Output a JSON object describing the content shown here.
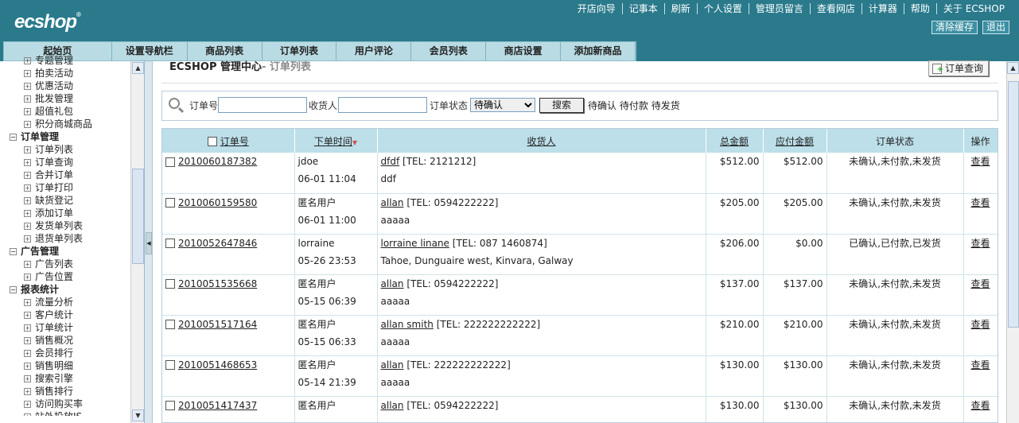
{
  "header": {
    "logo": "ecshop",
    "top_links": [
      "开店向导",
      "记事本",
      "刷新",
      "个人设置",
      "管理员留言",
      "查看网店",
      "计算器",
      "帮助",
      "关于 ECSHOP"
    ],
    "buttons": [
      "清除缓存",
      "退出"
    ]
  },
  "nav": [
    "起始页",
    "设置导航栏",
    "商品列表",
    "订单列表",
    "用户评论",
    "会员列表",
    "商店设置",
    "添加新商品"
  ],
  "sidebar": {
    "groups": [
      {
        "title": null,
        "items": [
          "专题管理",
          "拍卖活动",
          "优惠活动",
          "批发管理",
          "超值礼包",
          "积分商城商品"
        ]
      },
      {
        "title": "订单管理",
        "items": [
          "订单列表",
          "订单查询",
          "合并订单",
          "订单打印",
          "缺货登记",
          "添加订单",
          "发货单列表",
          "退货单列表"
        ]
      },
      {
        "title": "广告管理",
        "items": [
          "广告列表",
          "广告位置"
        ]
      },
      {
        "title": "报表统计",
        "items": [
          "流量分析",
          "客户统计",
          "订单统计",
          "销售概况",
          "会员排行",
          "销售明细",
          "搜索引擎",
          "销售排行",
          "访问购买率",
          "站外投放JS"
        ]
      }
    ]
  },
  "page": {
    "title": "ECSHOP 管理中心",
    "subtitle": "- 订单列表",
    "query_button": "订单查询"
  },
  "search": {
    "order_sn_label": "订单号",
    "consignee_label": "收货人",
    "status_label": "订单状态",
    "status_selected": "待确认",
    "submit": "搜索",
    "quick_links": [
      "待确认",
      "待付款",
      "待发货"
    ]
  },
  "table": {
    "headers": [
      "订单号",
      "下单时间",
      "收货人",
      "总金额",
      "应付金额",
      "订单状态",
      "操作"
    ],
    "rows": [
      {
        "sn": "2010060187382",
        "user": "jdoe",
        "time": "06-01 11:04",
        "name": "dfdf",
        "tel": "[TEL: 2121212]",
        "addr": "ddf",
        "total": "$512.00",
        "due": "$512.00",
        "status": "未确认,未付款,未发货",
        "op": "查看"
      },
      {
        "sn": "2010060159580",
        "user": "匿名用户",
        "time": "06-01 11:00",
        "name": "allan",
        "tel": "[TEL: 0594222222]",
        "addr": "aaaaa",
        "total": "$205.00",
        "due": "$205.00",
        "status": "未确认,未付款,未发货",
        "op": "查看"
      },
      {
        "sn": "2010052647846",
        "user": "lorraine",
        "time": "05-26 23:53",
        "name": "lorraine linane",
        "tel": "[TEL: 087 1460874]",
        "addr": "Tahoe, Dunguaire west, Kinvara, Galway",
        "total": "$206.00",
        "due": "$0.00",
        "status": "已确认,已付款,已发货",
        "op": "查看"
      },
      {
        "sn": "2010051535668",
        "user": "匿名用户",
        "time": "05-15 06:39",
        "name": "allan",
        "tel": "[TEL: 0594222222]",
        "addr": "aaaaa",
        "total": "$137.00",
        "due": "$137.00",
        "status": "未确认,未付款,未发货",
        "op": "查看"
      },
      {
        "sn": "2010051517164",
        "user": "匿名用户",
        "time": "05-15 06:33",
        "name": "allan smith",
        "tel": "[TEL: 222222222222]",
        "addr": "aaaaa",
        "total": "$210.00",
        "due": "$210.00",
        "status": "未确认,未付款,未发货",
        "op": "查看"
      },
      {
        "sn": "2010051468653",
        "user": "匿名用户",
        "time": "05-14 21:39",
        "name": "allan",
        "tel": "[TEL: 222222222222]",
        "addr": "aaaaa",
        "total": "$130.00",
        "due": "$130.00",
        "status": "未确认,未付款,未发货",
        "op": "查看"
      },
      {
        "sn": "2010051417437",
        "user": "匿名用户",
        "time": "",
        "name": "allan",
        "tel": "[TEL: 0594222222]",
        "addr": "",
        "total": "$130.00",
        "due": "$130.00",
        "status": "未确认,未付款,未发货",
        "op": "查看"
      }
    ]
  },
  "colors": {
    "header_bg": "#2a7a8c",
    "nav_bg": "#b9dbe3",
    "table_header_bg": "#bcdfe9"
  }
}
